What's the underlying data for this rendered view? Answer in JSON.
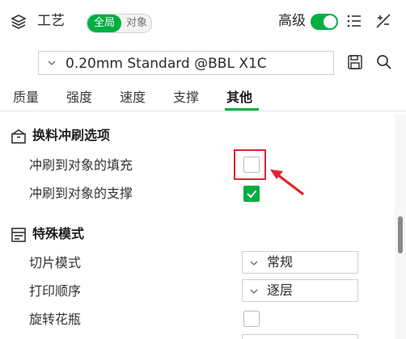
{
  "header": {
    "title": "工艺",
    "scope_global": "全局",
    "scope_object": "对象",
    "advanced_label": "高级",
    "advanced_enabled": true
  },
  "preset": {
    "value": "0.20mm Standard @BBL X1C"
  },
  "tabs": [
    {
      "label": "质量"
    },
    {
      "label": "强度"
    },
    {
      "label": "速度"
    },
    {
      "label": "支撑"
    },
    {
      "label": "其他",
      "active": true
    }
  ],
  "sections": {
    "flush": {
      "title": "换料冲刷选项",
      "icon": "flush-icon",
      "options": [
        {
          "label": "冲刷到对象的填充",
          "checked": false
        },
        {
          "label": "冲刷到对象的支撑",
          "checked": true
        }
      ]
    },
    "special": {
      "title": "特殊模式",
      "icon": "special-mode-icon",
      "slice_mode_label": "切片模式",
      "slice_mode_value": "常规",
      "print_sequence_label": "打印顺序",
      "print_sequence_value": "逐层",
      "spiral_vase_label": "旋转花瓶",
      "spiral_vase_checked": false
    }
  },
  "colors": {
    "accent": "#00ae42",
    "annotation": "#e0242f"
  }
}
